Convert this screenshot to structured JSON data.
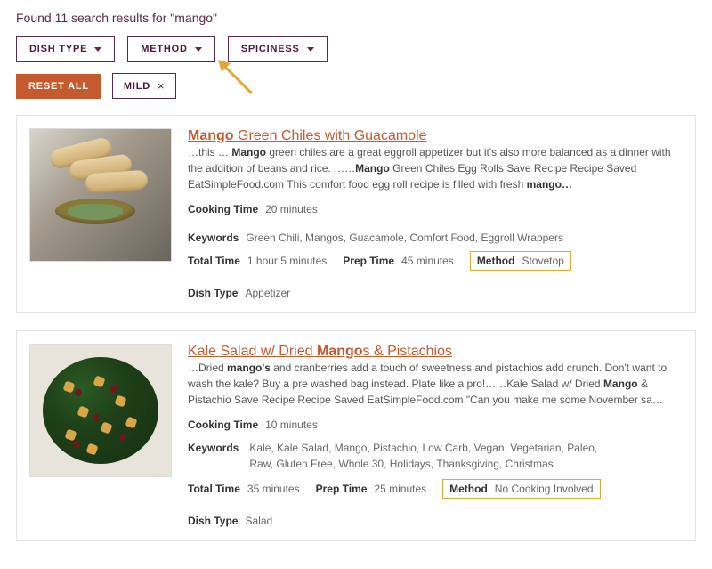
{
  "header": {
    "text": "Found 11 search results for \"mango\""
  },
  "filters": {
    "items": [
      {
        "label": "DISH TYPE"
      },
      {
        "label": "METHOD"
      },
      {
        "label": "SPICINESS"
      }
    ],
    "reset_label": "RESET ALL",
    "chips": [
      {
        "label": "MILD"
      }
    ]
  },
  "results": [
    {
      "title_parts": {
        "pre": "",
        "hl": "Mango",
        "post": " Green Chiles with Guacamole"
      },
      "snippet": "…this … <b>Mango</b> green chiles are a great eggroll appetizer but it's also more balanced as a dinner with the addition of beans and rice.  ……<b>Mango</b> Green Chiles Egg Rolls Save Recipe Recipe Saved EatSimpleFood.com This comfort food egg roll recipe is filled with fresh <b>mango…</b>",
      "cooking_time": "20 minutes",
      "keywords": "Green Chili, Mangos, Guacamole, Comfort Food, Eggroll Wrappers",
      "total_time": "1 hour 5 minutes",
      "prep_time": "45 minutes",
      "method": "Stovetop",
      "dish_type": "Appetizer"
    },
    {
      "title_parts": {
        "pre": "Kale Salad w/ Dried ",
        "hl": "Mango",
        "post": "s & Pistachios"
      },
      "snippet": "…Dried <b>mango's</b> and cranberries add a touch of sweetness and pistachios add crunch. Don't want to wash the kale?  Buy a pre washed bag instead. Plate like a pro!……Kale Salad w/ Dried <b>Mango</b> & Pistachio Save Recipe Recipe Saved EatSimpleFood.com \"Can you make me some November sa…",
      "cooking_time": "10 minutes",
      "keywords": "Kale, Kale Salad, Mango, Pistachio, Low Carb, Vegan, Vegetarian, Paleo, Raw, Gluten Free, Whole 30, Holidays, Thanksgiving, Christmas",
      "total_time": "35 minutes",
      "prep_time": "25 minutes",
      "method": "No Cooking Involved",
      "dish_type": "Salad"
    }
  ],
  "labels": {
    "cooking_time": "Cooking Time",
    "keywords": "Keywords",
    "total_time": "Total Time",
    "prep_time": "Prep Time",
    "method": "Method",
    "dish_type": "Dish Type"
  }
}
